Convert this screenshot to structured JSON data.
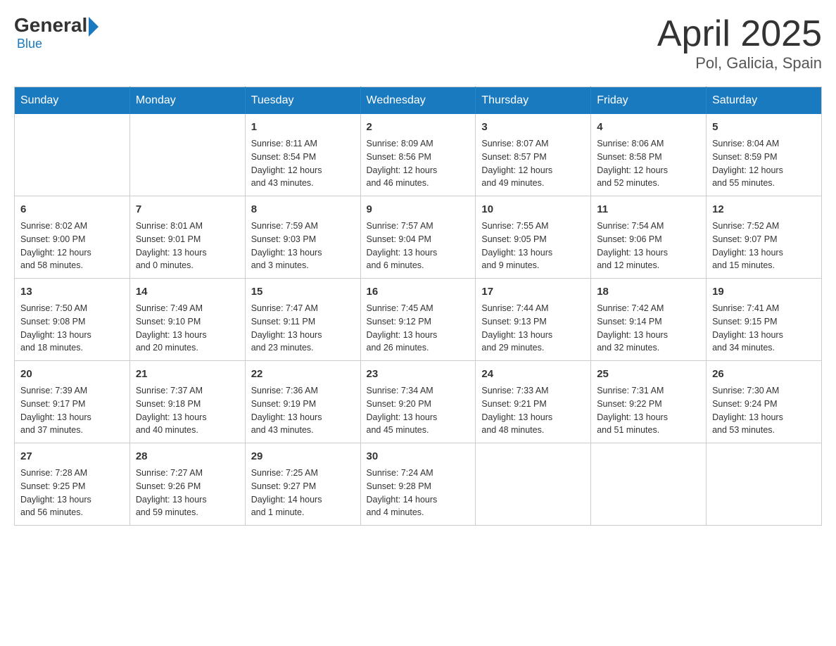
{
  "header": {
    "logo": {
      "general": "General",
      "blue": "Blue",
      "subtitle": "Blue"
    },
    "title": "April 2025",
    "location": "Pol, Galicia, Spain"
  },
  "weekdays": [
    "Sunday",
    "Monday",
    "Tuesday",
    "Wednesday",
    "Thursday",
    "Friday",
    "Saturday"
  ],
  "weeks": [
    [
      {
        "day": "",
        "info": ""
      },
      {
        "day": "",
        "info": ""
      },
      {
        "day": "1",
        "info": "Sunrise: 8:11 AM\nSunset: 8:54 PM\nDaylight: 12 hours\nand 43 minutes."
      },
      {
        "day": "2",
        "info": "Sunrise: 8:09 AM\nSunset: 8:56 PM\nDaylight: 12 hours\nand 46 minutes."
      },
      {
        "day": "3",
        "info": "Sunrise: 8:07 AM\nSunset: 8:57 PM\nDaylight: 12 hours\nand 49 minutes."
      },
      {
        "day": "4",
        "info": "Sunrise: 8:06 AM\nSunset: 8:58 PM\nDaylight: 12 hours\nand 52 minutes."
      },
      {
        "day": "5",
        "info": "Sunrise: 8:04 AM\nSunset: 8:59 PM\nDaylight: 12 hours\nand 55 minutes."
      }
    ],
    [
      {
        "day": "6",
        "info": "Sunrise: 8:02 AM\nSunset: 9:00 PM\nDaylight: 12 hours\nand 58 minutes."
      },
      {
        "day": "7",
        "info": "Sunrise: 8:01 AM\nSunset: 9:01 PM\nDaylight: 13 hours\nand 0 minutes."
      },
      {
        "day": "8",
        "info": "Sunrise: 7:59 AM\nSunset: 9:03 PM\nDaylight: 13 hours\nand 3 minutes."
      },
      {
        "day": "9",
        "info": "Sunrise: 7:57 AM\nSunset: 9:04 PM\nDaylight: 13 hours\nand 6 minutes."
      },
      {
        "day": "10",
        "info": "Sunrise: 7:55 AM\nSunset: 9:05 PM\nDaylight: 13 hours\nand 9 minutes."
      },
      {
        "day": "11",
        "info": "Sunrise: 7:54 AM\nSunset: 9:06 PM\nDaylight: 13 hours\nand 12 minutes."
      },
      {
        "day": "12",
        "info": "Sunrise: 7:52 AM\nSunset: 9:07 PM\nDaylight: 13 hours\nand 15 minutes."
      }
    ],
    [
      {
        "day": "13",
        "info": "Sunrise: 7:50 AM\nSunset: 9:08 PM\nDaylight: 13 hours\nand 18 minutes."
      },
      {
        "day": "14",
        "info": "Sunrise: 7:49 AM\nSunset: 9:10 PM\nDaylight: 13 hours\nand 20 minutes."
      },
      {
        "day": "15",
        "info": "Sunrise: 7:47 AM\nSunset: 9:11 PM\nDaylight: 13 hours\nand 23 minutes."
      },
      {
        "day": "16",
        "info": "Sunrise: 7:45 AM\nSunset: 9:12 PM\nDaylight: 13 hours\nand 26 minutes."
      },
      {
        "day": "17",
        "info": "Sunrise: 7:44 AM\nSunset: 9:13 PM\nDaylight: 13 hours\nand 29 minutes."
      },
      {
        "day": "18",
        "info": "Sunrise: 7:42 AM\nSunset: 9:14 PM\nDaylight: 13 hours\nand 32 minutes."
      },
      {
        "day": "19",
        "info": "Sunrise: 7:41 AM\nSunset: 9:15 PM\nDaylight: 13 hours\nand 34 minutes."
      }
    ],
    [
      {
        "day": "20",
        "info": "Sunrise: 7:39 AM\nSunset: 9:17 PM\nDaylight: 13 hours\nand 37 minutes."
      },
      {
        "day": "21",
        "info": "Sunrise: 7:37 AM\nSunset: 9:18 PM\nDaylight: 13 hours\nand 40 minutes."
      },
      {
        "day": "22",
        "info": "Sunrise: 7:36 AM\nSunset: 9:19 PM\nDaylight: 13 hours\nand 43 minutes."
      },
      {
        "day": "23",
        "info": "Sunrise: 7:34 AM\nSunset: 9:20 PM\nDaylight: 13 hours\nand 45 minutes."
      },
      {
        "day": "24",
        "info": "Sunrise: 7:33 AM\nSunset: 9:21 PM\nDaylight: 13 hours\nand 48 minutes."
      },
      {
        "day": "25",
        "info": "Sunrise: 7:31 AM\nSunset: 9:22 PM\nDaylight: 13 hours\nand 51 minutes."
      },
      {
        "day": "26",
        "info": "Sunrise: 7:30 AM\nSunset: 9:24 PM\nDaylight: 13 hours\nand 53 minutes."
      }
    ],
    [
      {
        "day": "27",
        "info": "Sunrise: 7:28 AM\nSunset: 9:25 PM\nDaylight: 13 hours\nand 56 minutes."
      },
      {
        "day": "28",
        "info": "Sunrise: 7:27 AM\nSunset: 9:26 PM\nDaylight: 13 hours\nand 59 minutes."
      },
      {
        "day": "29",
        "info": "Sunrise: 7:25 AM\nSunset: 9:27 PM\nDaylight: 14 hours\nand 1 minute."
      },
      {
        "day": "30",
        "info": "Sunrise: 7:24 AM\nSunset: 9:28 PM\nDaylight: 14 hours\nand 4 minutes."
      },
      {
        "day": "",
        "info": ""
      },
      {
        "day": "",
        "info": ""
      },
      {
        "day": "",
        "info": ""
      }
    ]
  ]
}
